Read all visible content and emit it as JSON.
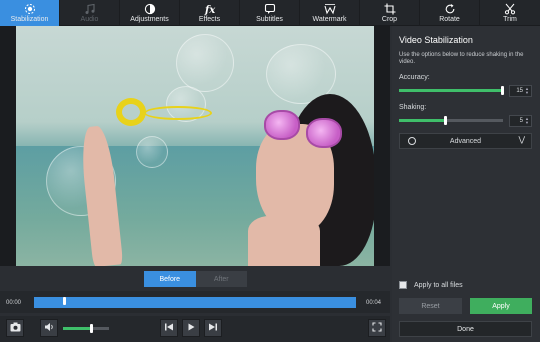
{
  "tabs": [
    {
      "label": "Stabilization",
      "icon": "stabilization-icon",
      "active": true
    },
    {
      "label": "Audio",
      "icon": "music-note-icon",
      "disabled": true
    },
    {
      "label": "Adjustments",
      "icon": "adjustments-icon"
    },
    {
      "label": "Effects",
      "icon": "fx-icon"
    },
    {
      "label": "Subtitles",
      "icon": "speech-bubble-icon"
    },
    {
      "label": "Watermark",
      "icon": "watermark-icon"
    },
    {
      "label": "Crop",
      "icon": "crop-icon"
    },
    {
      "label": "Rotate",
      "icon": "rotate-icon"
    },
    {
      "label": "Trim",
      "icon": "scissors-icon"
    }
  ],
  "preview": {
    "before_label": "Before",
    "after_label": "After"
  },
  "timeline": {
    "start_time": "00:00",
    "end_time": "00:04",
    "playhead_fraction": 0.09
  },
  "volume": {
    "level_fraction": 0.62
  },
  "panel": {
    "title": "Video Stabilization",
    "description": "Use the options below to reduce shaking in the video.",
    "accuracy_label": "Accuracy:",
    "accuracy_value": "15",
    "accuracy_fraction": 1.0,
    "shaking_label": "Shaking:",
    "shaking_value": "5",
    "shaking_fraction": 0.45,
    "advanced_label": "Advanced",
    "apply_all_label": "Apply to all files",
    "reset_label": "Reset",
    "apply_label": "Apply",
    "done_label": "Done"
  },
  "colors": {
    "accent_blue": "#3a8fe0",
    "accent_green": "#3fae5e",
    "panel_bg": "#2d3035"
  }
}
